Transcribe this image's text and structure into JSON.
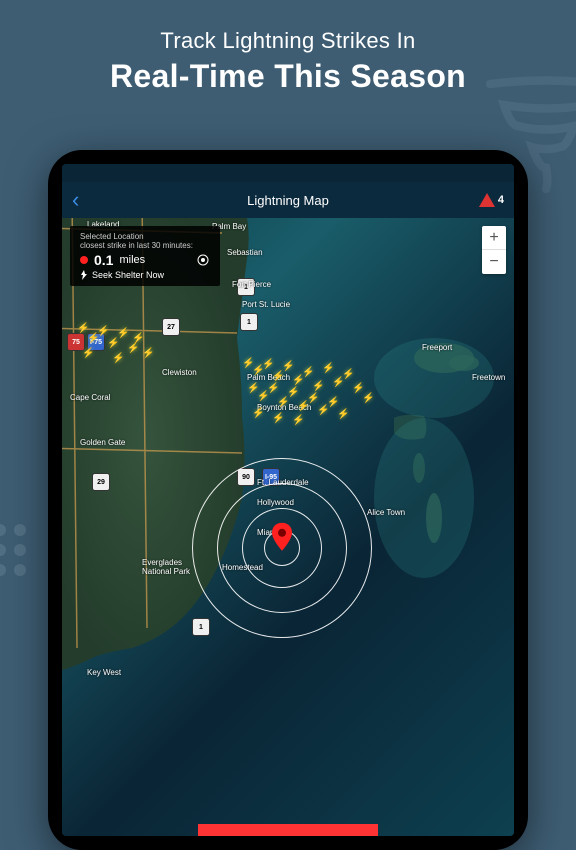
{
  "promo": {
    "subtitle": "Track Lightning Strikes In",
    "title": "Real-Time This Season"
  },
  "app": {
    "header_title": "Lightning Map",
    "alert_count": "4"
  },
  "info": {
    "selected": "Selected Location",
    "closest": "closest strike in last 30 minutes:",
    "distance": "0.1",
    "unit": "miles",
    "seek": "Seek Shelter Now"
  },
  "zoom": {
    "in": "+",
    "out": "−"
  },
  "cities": {
    "lakeland": "Lakeland",
    "palmbay": "Palm Bay",
    "sebastian": "Sebastian",
    "fortpierce": "Fort Pierce",
    "portstlucie": "Port St. Lucie",
    "clewiston": "Clewiston",
    "palmbeach": "Palm Beach",
    "capecoral": "Cape Coral",
    "goldengate": "Golden Gate",
    "boynton": "Boynton Beach",
    "lauderdale": "Ft. Lauderdale",
    "hollywood": "Hollywood",
    "miami": "Miami",
    "homestead": "Homestead",
    "everglades": "Everglades\nNational Park",
    "keywest": "Key West",
    "freeport": "Freeport",
    "freetown": "Freetown",
    "alicetown": "Alice Town"
  }
}
